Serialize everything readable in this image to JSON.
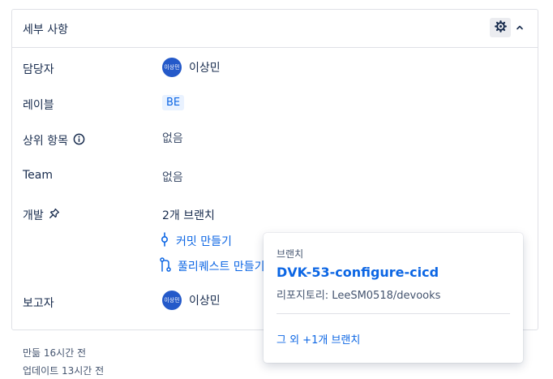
{
  "panel": {
    "title": "세부 사항"
  },
  "fields": {
    "assignee": {
      "label": "담당자",
      "avatar_text": "이상민",
      "name": "이상민"
    },
    "labels": {
      "label": "레이블",
      "value": "BE"
    },
    "parent": {
      "label": "상위 항목",
      "value": "없음"
    },
    "team": {
      "label": "Team",
      "value": "없음"
    },
    "development": {
      "label": "개발",
      "branches": "2개 브랜치",
      "create_commit": "커밋 만들기",
      "create_pr": "풀리퀘스트 만들기"
    },
    "reporter": {
      "label": "보고자",
      "avatar_text": "이상민",
      "name": "이상민"
    }
  },
  "popup": {
    "label": "브랜치",
    "branch_name": "DVK-53-configure-cicd",
    "repository": "리포지토리: LeeSM0518/devooks",
    "more_branches": "그 외 +1개 브랜치"
  },
  "footer": {
    "created": "만듦 16시간 전",
    "updated": "업데이트 13시간 전"
  },
  "colors": {
    "accent": "#0c66e4",
    "avatar": "#2459c9",
    "text": "#172b4d",
    "border": "#dfe1e6"
  },
  "icons": [
    "gear-icon",
    "chevron-up-icon",
    "info-icon",
    "pin-icon",
    "commit-icon",
    "pull-request-icon"
  ]
}
